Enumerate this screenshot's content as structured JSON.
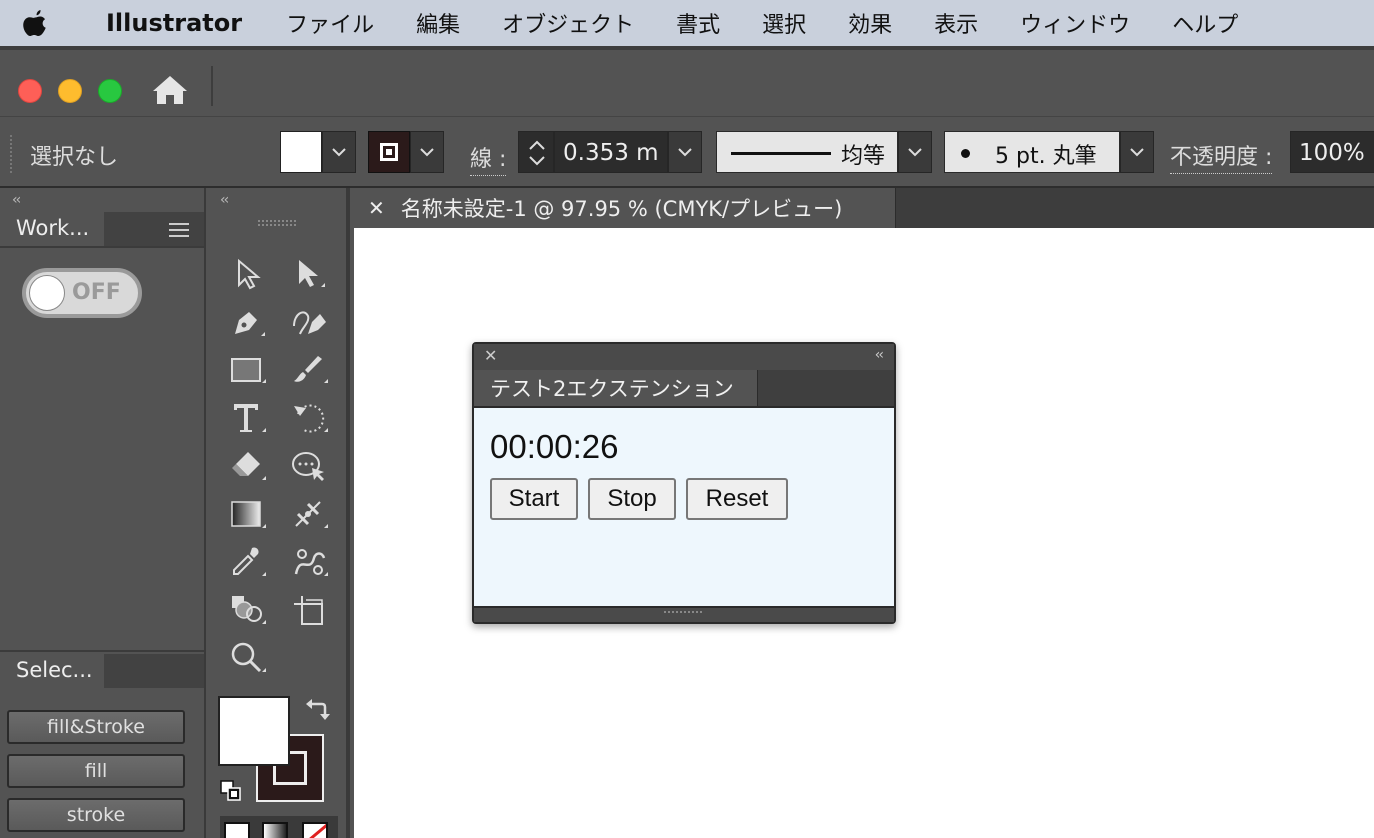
{
  "menubar": {
    "app_name": "Illustrator",
    "items": [
      "ファイル",
      "編集",
      "オブジェクト",
      "書式",
      "選択",
      "効果",
      "表示",
      "ウィンドウ",
      "ヘルプ"
    ]
  },
  "window": {
    "traffic_lights": {
      "close": "#fe5f57",
      "minimize": "#febc2e",
      "zoom": "#28c840"
    }
  },
  "control_bar": {
    "selection_status": "選択なし",
    "stroke_label": "線 :",
    "stroke_weight": "0.353 m",
    "profile_label": "均等",
    "brush_label": "5 pt. 丸筆",
    "opacity_label": "不透明度 :",
    "opacity_value": "100%"
  },
  "left_panel": {
    "collapse": "‹‹",
    "workspace_tab": "Work...",
    "toggle_label": "OFF",
    "select_tab": "Selec...",
    "buttons": [
      "fill&Stroke",
      "fill",
      "stroke"
    ]
  },
  "tools_panel": {
    "collapse": "‹‹"
  },
  "document": {
    "tab_title": "名称未設定-1 @ 97.95 % (CMYK/プレビュー)"
  },
  "extension": {
    "title": "テスト2エクステンション",
    "collapse": "‹‹",
    "timer": "00:00:26",
    "buttons": {
      "start": "Start",
      "stop": "Stop",
      "reset": "Reset"
    }
  }
}
